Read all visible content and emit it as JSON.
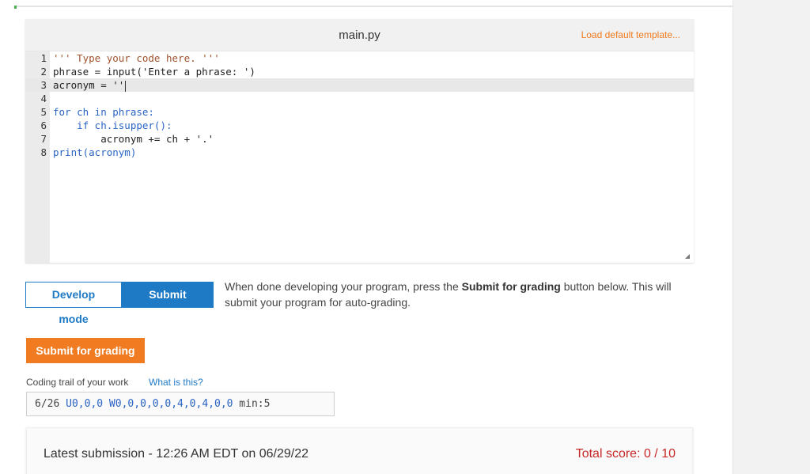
{
  "editor": {
    "filename": "main.py",
    "load_default": "Load default template...",
    "lines": [
      {
        "num": "1",
        "text": "''' Type your code here. '''"
      },
      {
        "num": "2",
        "text": "phrase = input('Enter a phrase: ')"
      },
      {
        "num": "3",
        "text": "acronym = ''"
      },
      {
        "num": "4",
        "text": ""
      },
      {
        "num": "5",
        "text": "for ch in phrase:"
      },
      {
        "num": "6",
        "text": "    if ch.isupper():"
      },
      {
        "num": "7",
        "text": "        acronym += ch + '.'"
      },
      {
        "num": "8",
        "text": "print(acronym)"
      }
    ]
  },
  "modes": {
    "develop_label": "Develop mode",
    "submit_label": "Submit mode",
    "description_pre": "When done developing your program, press the ",
    "description_bold": "Submit for grading",
    "description_post": " button below. This will submit your program for auto-grading."
  },
  "submit_button": "Submit for grading",
  "trail": {
    "label": "Coding trail of your work",
    "link": "What is this?",
    "prefix": "6/26 ",
    "u_part": "U0,0,0",
    "w_part": " W0,0,0,0,0,4,0,4,0,0",
    "suffix": " min:5"
  },
  "submission": {
    "latest": "Latest submission - 12:26 AM EDT on 06/29/22",
    "score": "Total score: 0 / 10"
  }
}
